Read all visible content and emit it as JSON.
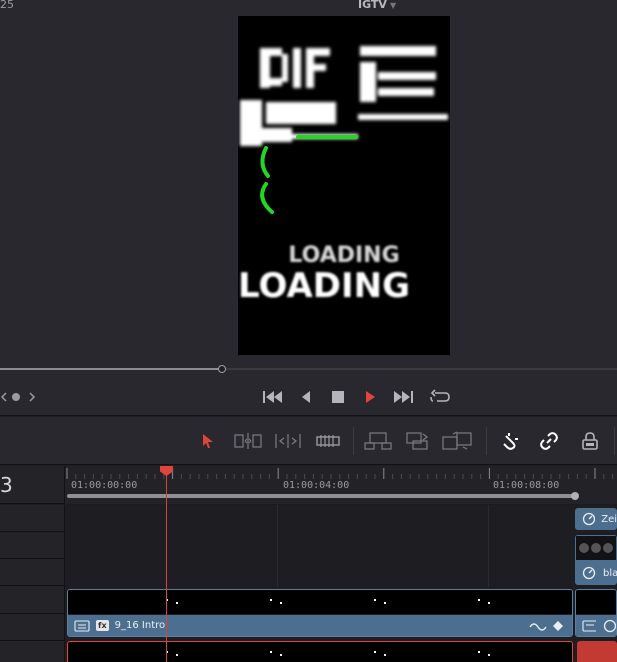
{
  "viewer": {
    "frame_rate_fragment": "25",
    "title": "IGTV",
    "preview_text_top": "LOADING",
    "preview_text_main": "LOADING"
  },
  "timeline": {
    "timecode_fragment": "3",
    "ruler": {
      "labels": [
        "01:00:00:00",
        "01:00:04:00",
        "01:00:08:00"
      ]
    },
    "clips": {
      "intro_name": "9_16 Intro",
      "intro_fx": "fx",
      "right_top_name": "Zei",
      "right_mid_name": "bla"
    }
  },
  "colors": {
    "accent_red": "#e0443a",
    "clip_blue": "#4d6f8f",
    "preview_green": "#22d622"
  }
}
